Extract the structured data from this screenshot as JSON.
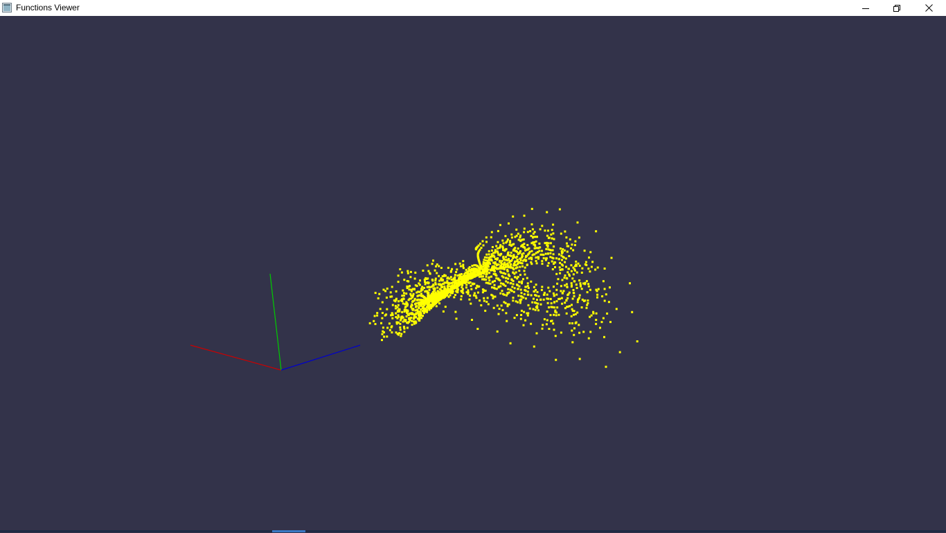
{
  "window": {
    "title": "Functions Viewer",
    "icons": {
      "app": "app-window-icon",
      "minimize": "minimize-icon",
      "maximize": "restore-icon",
      "close": "close-icon"
    }
  },
  "viewport": {
    "background_color": "#33334a",
    "point_color": "#ffff00",
    "axes": {
      "x_color": "#cc0000",
      "y_color": "#00cc00",
      "z_color": "#0000cc"
    }
  }
}
